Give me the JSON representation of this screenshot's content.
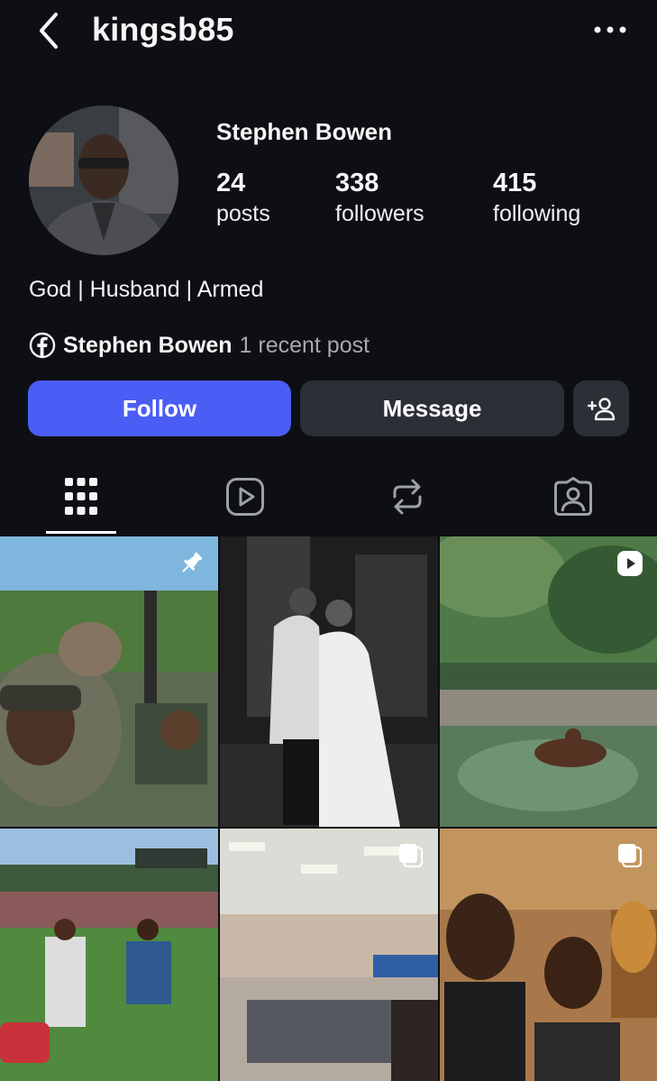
{
  "header": {
    "username": "kingsb85",
    "back_icon": "chevron-left-icon",
    "more_icon": "more-horizontal-icon"
  },
  "profile": {
    "full_name": "Stephen Bowen",
    "stats": {
      "posts": {
        "count": "24",
        "label": "posts"
      },
      "followers": {
        "count": "338",
        "label": "followers"
      },
      "following": {
        "count": "415",
        "label": "following"
      }
    },
    "bio": "God | Husband | Armed",
    "facebook": {
      "icon": "facebook-icon",
      "name": "Stephen Bowen",
      "recent": "1 recent post"
    }
  },
  "actions": {
    "follow_label": "Follow",
    "message_label": "Message",
    "add_user_icon": "add-user-icon"
  },
  "tabs": [
    {
      "name": "posts",
      "icon": "grid-icon",
      "selected": true
    },
    {
      "name": "reels",
      "icon": "reels-icon",
      "selected": false
    },
    {
      "name": "reposts",
      "icon": "repost-icon",
      "selected": false
    },
    {
      "name": "tagged",
      "icon": "tagged-icon",
      "selected": false
    }
  ],
  "grid": [
    {
      "badge": "pin-icon"
    },
    {
      "badge": null
    },
    {
      "badge": "reel-icon"
    },
    {
      "badge": null
    },
    {
      "badge": "carousel-icon"
    },
    {
      "badge": "carousel-icon"
    }
  ],
  "colors": {
    "background": "#0d0f14",
    "follow_button": "#4a5df5",
    "secondary_button": "#2c2f36",
    "muted_text": "#a8a8b0"
  }
}
